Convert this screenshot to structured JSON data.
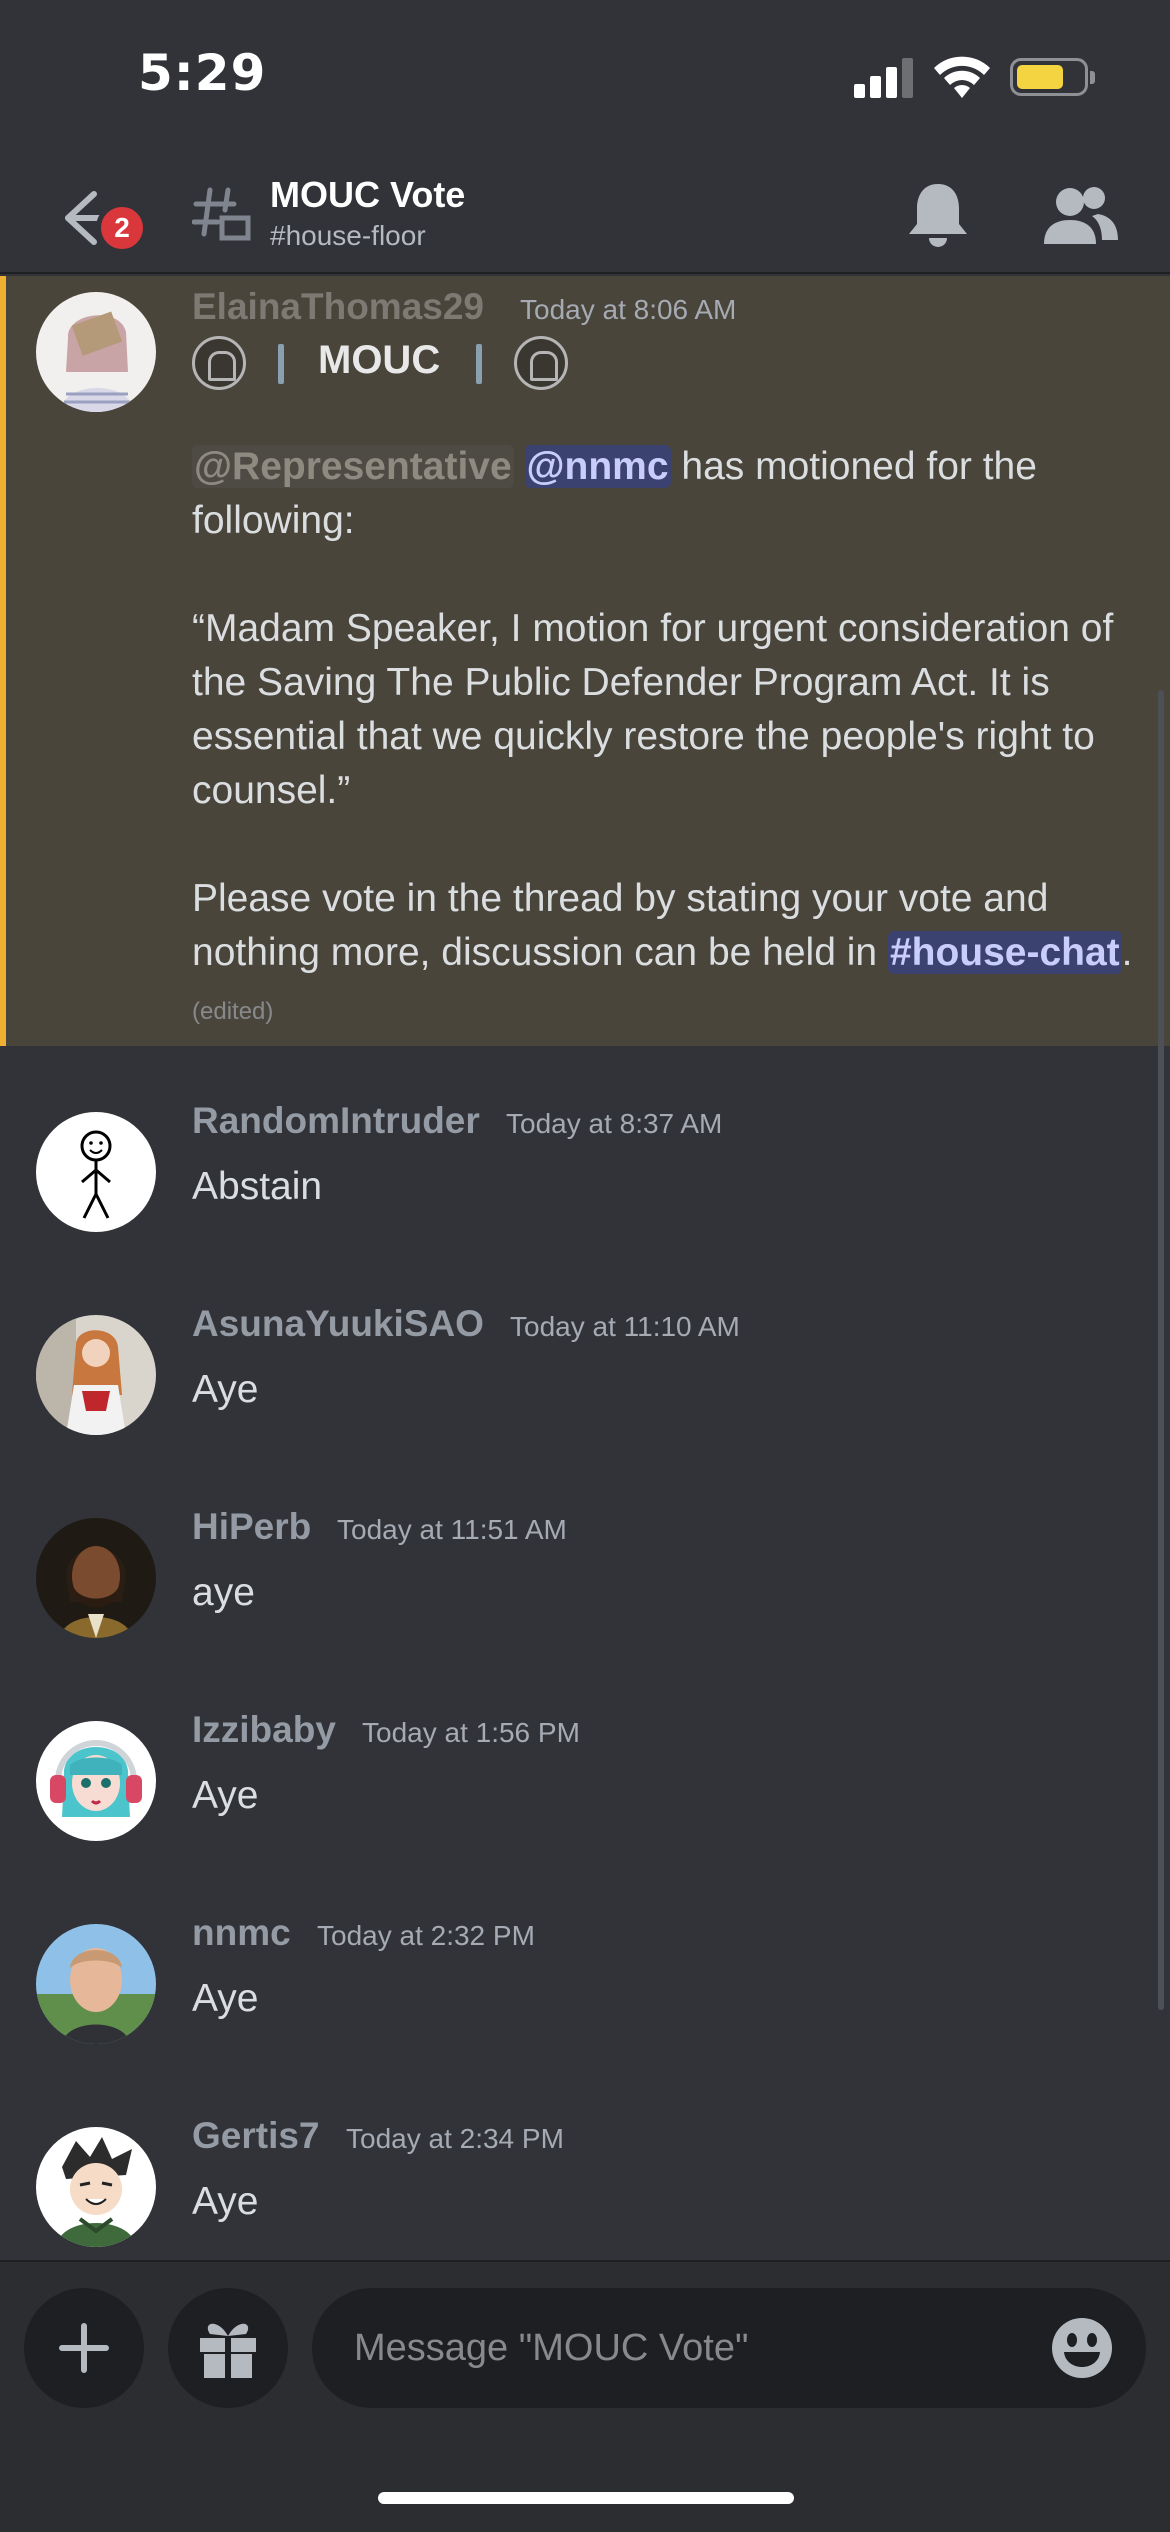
{
  "status": {
    "time": "5:29"
  },
  "header": {
    "badge": "2",
    "title": "MOUC Vote",
    "subtitle": "#house-floor"
  },
  "highlighted_message": {
    "author": "ElainaThomas29",
    "timestamp": "Today at 8:06 AM",
    "role_banner": "MOUC",
    "mention_role": "@Representative",
    "mention_user": "@nnmc",
    "line1_rest": " has motioned for the following:",
    "quote": "“Madam Speaker, I motion for urgent consideration of the Saving The Public Defender Program Act. It is essential that we quickly restore the people's right to counsel.”",
    "vote_text": "Please vote in the thread by stating your vote and nothing more, discussion can be held in ",
    "channel_mention": "#house-chat",
    "period": ".",
    "edited": "(edited)"
  },
  "messages": [
    {
      "author": "RandomIntruder",
      "timestamp": "Today at 8:37 AM",
      "text": "Abstain",
      "avatar": "stick-figure"
    },
    {
      "author": "AsunaYuukiSAO",
      "timestamp": "Today at 11:10 AM",
      "text": "Aye",
      "avatar": "cosplay-photo"
    },
    {
      "author": "HiPerb",
      "timestamp": "Today at 11:51 AM",
      "text": "aye",
      "avatar": "portrait"
    },
    {
      "author": "Izzibaby",
      "timestamp": "Today at 1:56 PM",
      "text": "Aye",
      "avatar": "anime-girl"
    },
    {
      "author": "nnmc",
      "timestamp": "Today at 2:32 PM",
      "text": "Aye",
      "avatar": "3d-avatar"
    },
    {
      "author": "Gertis7",
      "timestamp": "Today at 2:34 PM",
      "text": "Aye",
      "avatar": "cartoon-boy"
    }
  ],
  "composer": {
    "placeholder": "Message \"MOUC Vote\""
  },
  "colors": {
    "background": "#313338",
    "highlight": "#4a453b",
    "highlight_border": "#f0b132",
    "badge": "#da373c",
    "mention": "#c9cdfb"
  }
}
